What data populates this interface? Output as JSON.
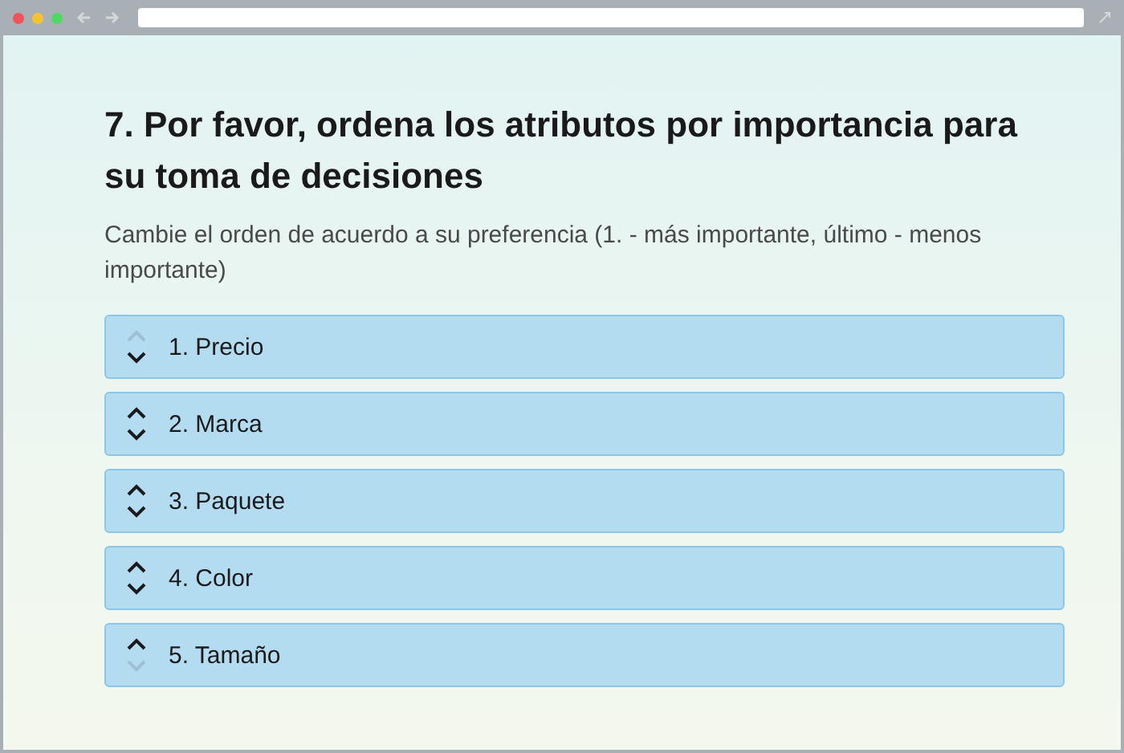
{
  "question": {
    "title": "7. Por favor, ordena los atributos por importancia para su toma de decisiones",
    "subtitle": "Cambie el orden de acuerdo a su preferencia (1. - más importante, último - menos importante)"
  },
  "items": [
    {
      "label": "1. Precio",
      "up_disabled": true,
      "down_disabled": false
    },
    {
      "label": "2. Marca",
      "up_disabled": false,
      "down_disabled": false
    },
    {
      "label": "3. Paquete",
      "up_disabled": false,
      "down_disabled": false
    },
    {
      "label": "4. Color",
      "up_disabled": false,
      "down_disabled": false
    },
    {
      "label": "5. Tamaño",
      "up_disabled": false,
      "down_disabled": true
    }
  ]
}
